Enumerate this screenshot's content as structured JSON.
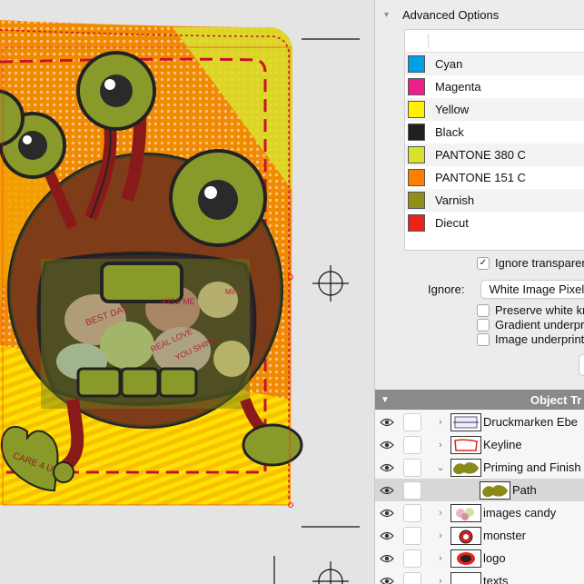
{
  "panel": {
    "advanced_options_label": "Advanced Options",
    "separations": [
      {
        "name": "Cyan",
        "color": "#00a0e6"
      },
      {
        "name": "Magenta",
        "color": "#ec1f8c"
      },
      {
        "name": "Yellow",
        "color": "#fff200"
      },
      {
        "name": "Black",
        "color": "#231f20"
      },
      {
        "name": "PANTONE 380 C",
        "color": "#d9e22b"
      },
      {
        "name": "PANTONE 151 C",
        "color": "#ff7f00"
      },
      {
        "name": "Varnish",
        "color": "#8f8f1a"
      },
      {
        "name": "Diecut",
        "color": "#e8231b"
      }
    ],
    "ignore_transparency_label": "Ignore transparen",
    "ignore_transparency_checked": true,
    "ignore_label": "Ignore:",
    "ignore_select_value": "White Image Pixel",
    "preserve_white_label": "Preserve white kn",
    "gradient_underprint_label": "Gradient underpri",
    "image_underprint_label": "Image underprint"
  },
  "object_tree": {
    "title": "Object Tr",
    "rows": [
      {
        "label": "Druckmarken Ebe",
        "disclosure": "›",
        "thumb": "marks",
        "selected": false
      },
      {
        "label": "Keyline",
        "disclosure": "›",
        "thumb": "keyline",
        "selected": false
      },
      {
        "label": "Priming and Finish",
        "disclosure": "⌄",
        "thumb": "olive",
        "selected": false
      },
      {
        "label": "Path",
        "disclosure": "",
        "thumb": "olive",
        "selected": true
      },
      {
        "label": "images candy",
        "disclosure": "›",
        "thumb": "candy",
        "selected": false
      },
      {
        "label": "monster",
        "disclosure": "›",
        "thumb": "monster",
        "selected": false
      },
      {
        "label": "logo",
        "disclosure": "›",
        "thumb": "logo",
        "selected": false
      },
      {
        "label": "texts",
        "disclosure": "›",
        "thumb": "blank",
        "selected": false
      }
    ]
  },
  "artwork": {
    "candy_texts": [
      "BEST DAY",
      "KISS ME",
      "REAL LOVE",
      "YOU SHINE",
      "CARE 4 U",
      "MINE"
    ]
  }
}
